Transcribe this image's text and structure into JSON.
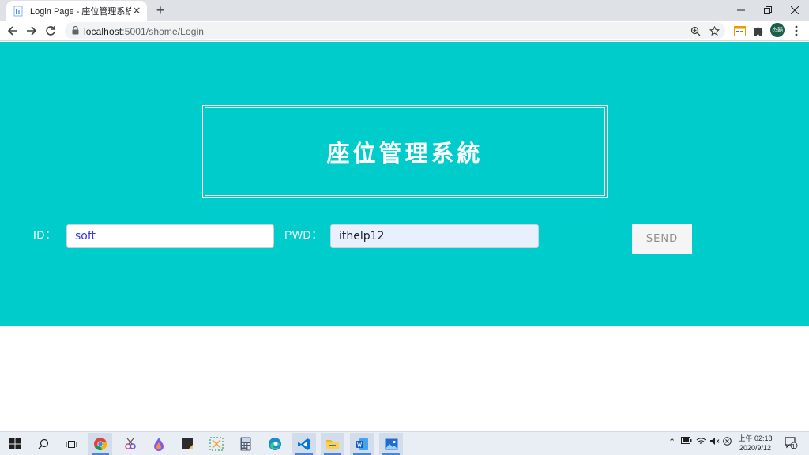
{
  "browser": {
    "tab_title": "Login Page - 座位管理系統",
    "url_host": "localhost",
    "url_rest": ":5001/shome/Login",
    "profile_initials": "杰韜"
  },
  "page": {
    "heading": "座位管理系統",
    "id_label": "ID：",
    "id_value": "soft",
    "pwd_label": "PWD：",
    "pwd_value": "ithelp12",
    "send_label": "SEND",
    "colors": {
      "hero_bg": "#00cccc",
      "id_text": "#3b34d6",
      "autofill_bg": "#e8f0fe"
    }
  },
  "taskbar": {
    "apps": [
      "windows-start-icon",
      "search-icon",
      "task-view-icon",
      "chrome-icon",
      "snip-icon",
      "paint3d-icon",
      "sticky-notes-icon",
      "snipping-tool-icon",
      "calculator-icon",
      "edge-icon",
      "vscode-icon",
      "file-explorer-icon",
      "word-icon",
      "photos-icon"
    ],
    "clock_time": "上午 02:18",
    "clock_date": "2020/9/12",
    "notification_count": "1"
  }
}
